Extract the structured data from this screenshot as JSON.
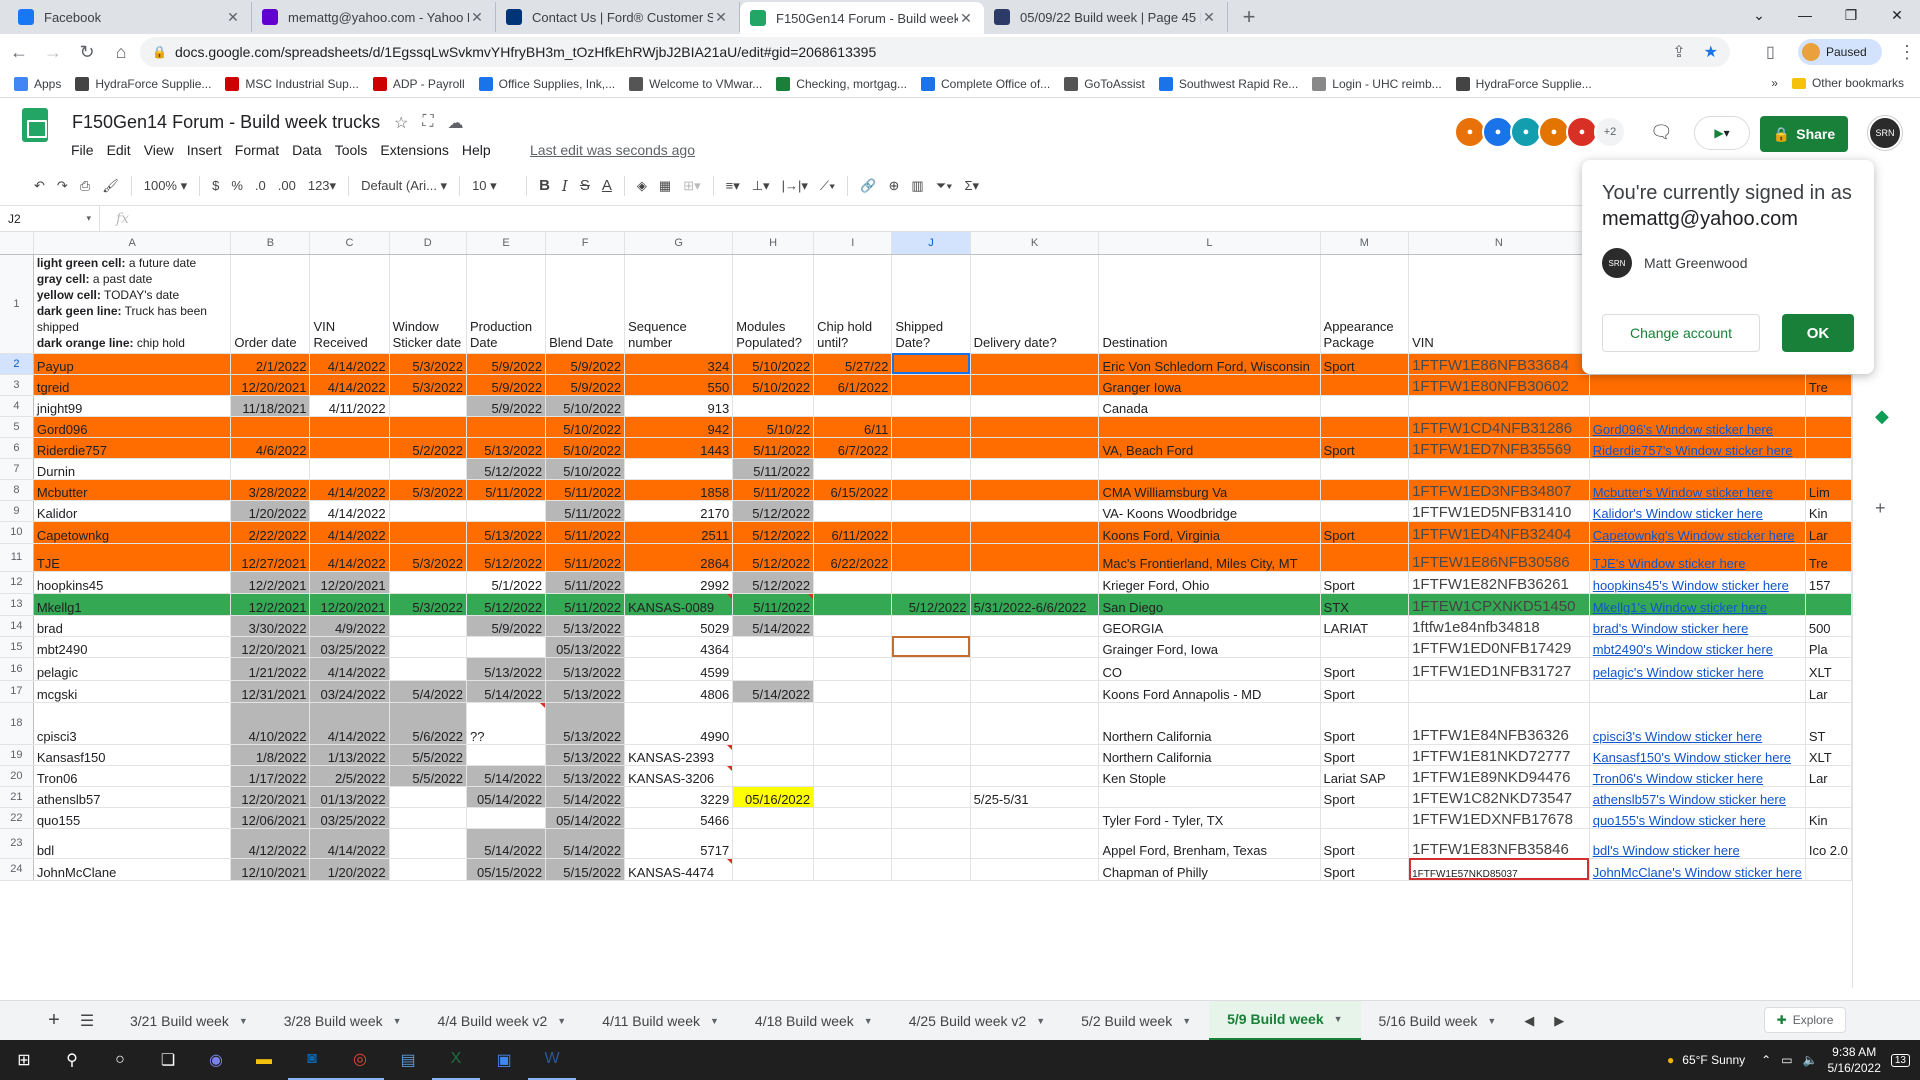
{
  "browser": {
    "tabs": [
      {
        "title": "Facebook",
        "color": "#1877f2",
        "icon": "facebook-icon"
      },
      {
        "title": "memattg@yahoo.com - Yahoo M",
        "color": "#6001d2",
        "icon": "yahoo-mail-icon"
      },
      {
        "title": "Contact Us | Ford® Customer Se",
        "color": "#003478",
        "icon": "ford-icon"
      },
      {
        "title": "F150Gen14 Forum - Build week t",
        "color": "#23a566",
        "icon": "sheets-icon"
      },
      {
        "title": "05/09/22 Build week | Page 45 | F",
        "color": "#2b3a67",
        "icon": "forum-icon"
      }
    ],
    "url": "docs.google.com/spreadsheets/d/1EgssqLwSvkmvYHfryBH3m_tOzHfkEhRWjbJ2BIA21aU/edit#gid=2068613395",
    "profile_label": "Paused",
    "bookmarks": [
      "Apps",
      "HydraForce Supplie...",
      "MSC Industrial Sup...",
      "ADP - Payroll",
      "Office Supplies, Ink,...",
      "Welcome to VMwar...",
      "Checking, mortgag...",
      "Complete Office of...",
      "GoToAssist",
      "Southwest Rapid Re...",
      "Login - UHC reimb...",
      "HydraForce Supplie..."
    ],
    "other_bookmarks": "Other bookmarks"
  },
  "sheet": {
    "title": "F150Gen14 Forum - Build week trucks",
    "menu": [
      "File",
      "Edit",
      "View",
      "Insert",
      "Format",
      "Data",
      "Tools",
      "Extensions",
      "Help"
    ],
    "last_edit": "Last edit was seconds ago",
    "collab_more": "+2",
    "share_label": "Share",
    "toolbar": {
      "zoom": "100%",
      "currency": "$",
      "percent": "%",
      "dec_dec": ".0",
      "dec_inc": ".00",
      "format": "123",
      "font": "Default (Ari...",
      "size": "10"
    },
    "name_box": "J2",
    "columns": [
      "A",
      "B",
      "C",
      "D",
      "E",
      "F",
      "G",
      "H",
      "I",
      "J",
      "K",
      "L",
      "M",
      "N",
      "O"
    ],
    "legend": [
      {
        "label": "light green cell:",
        "text": " a future date"
      },
      {
        "label": "gray cell:",
        "text": " a past date"
      },
      {
        "label": "yellow cell:",
        "text": " TODAY's date"
      },
      {
        "label": "dark geen line:",
        "text": " Truck has been shipped"
      },
      {
        "label": "dark orange line:",
        "text": " chip hold"
      }
    ],
    "headers": [
      "Order date",
      "VIN Received",
      "Window Sticker date",
      "Production Date",
      "Blend Date",
      "Sequence number",
      "Modules Populated?",
      "Chip hold until?",
      "Shipped Date?",
      "Delivery date?",
      "Destination",
      "Appearance Package",
      "VIN",
      ""
    ],
    "rows": [
      {
        "n": "2",
        "style": "orange",
        "h": 21,
        "c": [
          "Payup",
          "2/1/2022",
          "4/14/2022",
          "5/3/2022",
          "5/9/2022",
          "5/9/2022",
          "324",
          "5/10/2022",
          "5/27/22",
          "",
          "",
          "Eric Von Schledorn Ford, Wisconsin",
          "Sport",
          "1FTFW1E86NFB33684",
          "Payup's Window sticker here",
          "Lar"
        ]
      },
      {
        "n": "3",
        "style": "orange",
        "h": 21,
        "c": [
          "tgreid",
          "12/20/2021",
          "4/14/2022",
          "5/3/2022",
          "5/9/2022",
          "5/9/2022",
          "550",
          "5/10/2022",
          "6/1/2022",
          "",
          "",
          "Granger Iowa",
          "",
          "1FTFW1E80NFB30602",
          "",
          "Tre"
        ]
      },
      {
        "n": "4",
        "style": "",
        "h": 21,
        "c": [
          "jnight99",
          "11/18/2021",
          "4/11/2022",
          "",
          "5/9/2022",
          "5/10/2022",
          "913",
          "",
          "",
          "",
          "",
          "Canada",
          "",
          "",
          "",
          ""
        ]
      },
      {
        "n": "5",
        "style": "orange",
        "h": 21,
        "c": [
          "Gord096",
          "",
          "",
          "",
          "",
          "5/10/2022",
          "942",
          "5/10/22",
          "6/11",
          "",
          "",
          "",
          "",
          "1FTFW1CD4NFB31286",
          "Gord096's Window sticker here",
          ""
        ]
      },
      {
        "n": "6",
        "style": "orange",
        "h": 21,
        "c": [
          "Riderdie757",
          "4/6/2022",
          "",
          "5/2/2022",
          "5/13/2022",
          "5/10/2022",
          "1443",
          "5/11/2022",
          "6/7/2022",
          "",
          "",
          "VA, Beach Ford",
          "Sport",
          "1FTFW1ED7NFB35569",
          "Riderdie757's Window sticker here",
          ""
        ]
      },
      {
        "n": "7",
        "style": "",
        "h": 21,
        "c": [
          "Durnin",
          "",
          "",
          "",
          "5/12/2022",
          "5/10/2022",
          "",
          "5/11/2022",
          "",
          "",
          "",
          "",
          "",
          "",
          "",
          ""
        ]
      },
      {
        "n": "8",
        "style": "orange",
        "h": 21,
        "c": [
          "Mcbutter",
          "3/28/2022",
          "4/14/2022",
          "5/3/2022",
          "5/11/2022",
          "5/11/2022",
          "1858",
          "5/11/2022",
          "6/15/2022",
          "",
          "",
          "CMA Williamsburg Va",
          "",
          "1FTFW1ED3NFB34807",
          "Mcbutter's Window sticker here",
          "Lim"
        ]
      },
      {
        "n": "9",
        "style": "",
        "h": 19,
        "c": [
          "Kalidor",
          "1/20/2022",
          "4/14/2022",
          "",
          "",
          "5/11/2022",
          "2170",
          "5/12/2022",
          "",
          "",
          "",
          "VA- Koons Woodbridge",
          "",
          "1FTFW1ED5NFB31410",
          "Kalidor's Window sticker here",
          "Kin"
        ]
      },
      {
        "n": "10",
        "style": "orange",
        "h": 22,
        "c": [
          "Capetownkg",
          "2/22/2022",
          "4/14/2022",
          "",
          "5/13/2022",
          "5/11/2022",
          "2511",
          "5/12/2022",
          "6/11/2022",
          "",
          "",
          "Koons Ford, Virginia",
          "Sport",
          "1FTFW1ED4NFB32404",
          "Capetownkg's Window sticker here",
          "Lar"
        ]
      },
      {
        "n": "11",
        "style": "orange",
        "h": 28,
        "c": [
          "TJE",
          "12/27/2021",
          "4/14/2022",
          "5/3/2022",
          "5/12/2022",
          "5/11/2022",
          "2864",
          "5/12/2022",
          "6/22/2022",
          "",
          "",
          "Mac's Frontierland, Miles City, MT",
          "",
          "1FTEW1E86NFB30586",
          "TJE's Window sticker here",
          "Tre"
        ]
      },
      {
        "n": "12",
        "style": "",
        "h": 22,
        "c": [
          "hoopkins45",
          "12/2/2021",
          "12/20/2021",
          "",
          "5/1/2022",
          "5/11/2022",
          "2992",
          "5/12/2022",
          "",
          "",
          "",
          "Krieger Ford, Ohio",
          "Sport",
          "1FTFW1E82NFB36261",
          "hoopkins45's Window sticker here",
          "157"
        ]
      },
      {
        "n": "13",
        "style": "green",
        "h": 22,
        "c": [
          "Mkellg1",
          "12/2/2021",
          "12/20/2021",
          "5/3/2022",
          "5/12/2022",
          "5/11/2022",
          "KANSAS-0089",
          "5/11/2022",
          "",
          "5/12/2022",
          "5/31/2022-6/6/2022",
          "San Diego",
          "STX",
          "1FTEW1CPXNKD51450",
          "Mkellg1's Window sticker here",
          ""
        ]
      },
      {
        "n": "14",
        "style": "",
        "h": 21,
        "c": [
          "brad",
          "3/30/2022",
          "4/9/2022",
          "",
          "5/9/2022",
          "5/13/2022",
          "5029",
          "5/14/2022",
          "",
          "",
          "",
          "GEORGIA",
          "LARIAT",
          "1ftfw1e84nfb34818",
          "brad's Window sticker here",
          "500"
        ]
      },
      {
        "n": "15",
        "style": "",
        "h": 19,
        "c": [
          "mbt2490",
          "12/20/2021",
          "03/25/2022",
          "",
          "",
          "05/13/2022",
          "4364",
          "",
          "",
          "",
          "",
          "Grainger Ford, Iowa",
          "",
          "1FTFW1ED0NFB17429",
          "mbt2490's Window sticker here",
          "Pla"
        ]
      },
      {
        "n": "16",
        "style": "",
        "h": 23,
        "c": [
          "pelagic",
          "1/21/2022",
          "4/14/2022",
          "",
          "5/13/2022",
          "5/13/2022",
          "4599",
          "",
          "",
          "",
          "",
          "CO",
          "Sport",
          "1FTFW1ED1NFB31727",
          "pelagic's Window sticker here",
          "XLT"
        ]
      },
      {
        "n": "17",
        "style": "",
        "h": 22,
        "c": [
          "mcgski",
          "12/31/2021",
          "03/24/2022",
          "5/4/2022",
          "5/14/2022",
          "5/13/2022",
          "4806",
          "5/14/2022",
          "",
          "",
          "",
          "Koons Ford Annapolis - MD",
          "Sport",
          "",
          "",
          "Lar"
        ]
      },
      {
        "n": "18",
        "style": "",
        "h": 42,
        "c": [
          "cpisci3",
          "4/10/2022",
          "4/14/2022",
          "5/6/2022",
          "??",
          "5/13/2022",
          "4990",
          "",
          "",
          "",
          "",
          "Northern California",
          "Sport",
          "1FTFW1E84NFB36326",
          "cpisci3's Window sticker here",
          "ST"
        ]
      },
      {
        "n": "19",
        "style": "",
        "h": 21,
        "c": [
          "Kansasf150",
          "1/8/2022",
          "1/13/2022",
          "5/5/2022",
          "",
          "5/13/2022",
          "KANSAS-2393",
          "",
          "",
          "",
          "",
          "Northern California",
          "Sport",
          "1FTFW1E81NKD72777",
          "Kansasf150's Window sticker here",
          "XLT"
        ]
      },
      {
        "n": "20",
        "style": "",
        "h": 21,
        "c": [
          "Tron06",
          "1/17/2022",
          "2/5/2022",
          "5/5/2022",
          "5/14/2022",
          "5/13/2022",
          "KANSAS-3206",
          "",
          "",
          "",
          "",
          "Ken Stople",
          "Lariat SAP",
          "1FTFW1E89NKD94476",
          "Tron06's Window sticker here",
          "Lar"
        ]
      },
      {
        "n": "21",
        "style": "",
        "h": 21,
        "c": [
          "athenslb57",
          "12/20/2021",
          "01/13/2022",
          "",
          "05/14/2022",
          "5/14/2022",
          "3229",
          "05/16/2022",
          "",
          "",
          "5/25-5/31",
          "",
          "Sport",
          "1FTEW1C82NKD73547",
          "athenslb57's Window sticker here",
          ""
        ]
      },
      {
        "n": "22",
        "style": "",
        "h": 21,
        "c": [
          "quo155",
          "12/06/2021",
          "03/25/2022",
          "",
          "",
          "05/14/2022",
          "5466",
          "",
          "",
          "",
          "",
          "Tyler Ford - Tyler, TX",
          "",
          "1FTFW1EDXNFB17678",
          "quo155's Window sticker here",
          "Kin"
        ]
      },
      {
        "n": "23",
        "style": "",
        "h": 30,
        "c": [
          "bdl",
          "4/12/2022",
          "4/14/2022",
          "",
          "5/14/2022",
          "5/14/2022",
          "5717",
          "",
          "",
          "",
          "",
          "Appel Ford, Brenham, Texas",
          "Sport",
          "1FTFW1E83NFB35846",
          "bdl's Window sticker here",
          "Ico 2.0"
        ]
      },
      {
        "n": "24",
        "style": "",
        "h": 22,
        "c": [
          "JohnMcClane",
          "12/10/2021",
          "1/20/2022",
          "",
          "05/15/2022",
          "5/15/2022",
          "KANSAS-4474",
          "",
          "",
          "",
          "",
          "Chapman of Philly",
          "Sport",
          "1FTFW1E57NKD85037",
          "JohnMcClane's Window sticker here",
          ""
        ]
      }
    ],
    "sheet_tabs": [
      "3/21 Build week",
      "3/28 Build week",
      "4/4 Build week v2",
      "4/11 Build week",
      "4/18 Build week",
      "4/25 Build week v2",
      "5/2 Build week",
      "5/9 Build week",
      "5/16 Build week"
    ],
    "active_tab": "5/9 Build week",
    "explore_label": "Explore"
  },
  "popup": {
    "line1": "You're currently signed in as",
    "email": "memattg@yahoo.com",
    "user_name": "Matt Greenwood",
    "change_account": "Change account",
    "ok": "OK"
  },
  "taskbar": {
    "weather": "65°F  Sunny",
    "time": "9:38 AM",
    "date": "5/16/2022",
    "notifications": "13"
  },
  "colors": {
    "orange_row": "#ff6d01",
    "green_row": "#34a853",
    "past_date_gray": "#b7b7b7",
    "today_yellow": "#ffff00",
    "share_green": "#188038"
  }
}
